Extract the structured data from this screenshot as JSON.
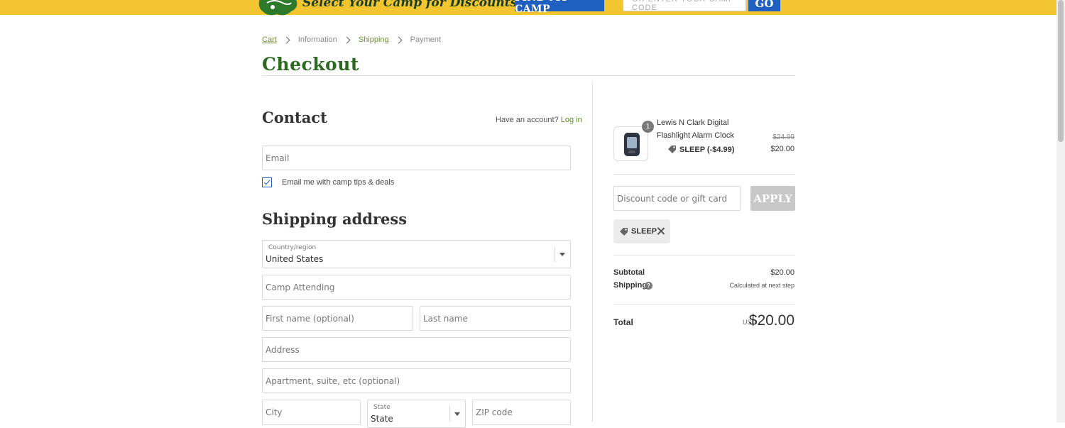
{
  "banner": {
    "tagline": "Select Your Camp for Discounts & More!",
    "find_button": "FIND MY CAMP",
    "camp_code_placeholder": "OR ENTER YOUR CAMP CODE",
    "go_button": "GO",
    "color": "#f2c531",
    "button_color": "#1e5fbf"
  },
  "breadcrumb": {
    "items": [
      "Cart",
      "Information",
      "Shipping",
      "Payment"
    ]
  },
  "page": {
    "title": "Checkout",
    "title_color": "#2b6a1f"
  },
  "contact": {
    "heading": "Contact",
    "account_prompt": "Have an account?",
    "login_link": "Log in",
    "email_placeholder": "Email",
    "newsletter_label": "Email me with camp tips & deals",
    "newsletter_checked": true
  },
  "shipping": {
    "heading": "Shipping address",
    "country_label": "Country/region",
    "country_value": "United States",
    "camp_placeholder": "Camp Attending",
    "first_name_placeholder": "First name (optional)",
    "last_name_placeholder": "Last name",
    "address_placeholder": "Address",
    "apartment_placeholder": "Apartment, suite, etc (optional)",
    "city_placeholder": "City",
    "state_label": "State",
    "state_value": "State",
    "zip_placeholder": "ZIP code"
  },
  "order": {
    "product": {
      "quantity": "1",
      "name": "Lewis N Clark Digital Flashlight Alarm Clock",
      "discount_label": "SLEEP (-$4.99)",
      "price_original": "$24.99",
      "price_final": "$20.00"
    },
    "discount_placeholder": "Discount code or gift card",
    "apply_button": "APPLY",
    "applied_code": "SLEEP",
    "subtotal_label": "Subtotal",
    "subtotal_value": "$20.00",
    "shipping_label": "Shipping",
    "shipping_value": "Calculated at next step",
    "total_label": "Total",
    "total_currency": "USD",
    "total_value": "$20.00"
  }
}
